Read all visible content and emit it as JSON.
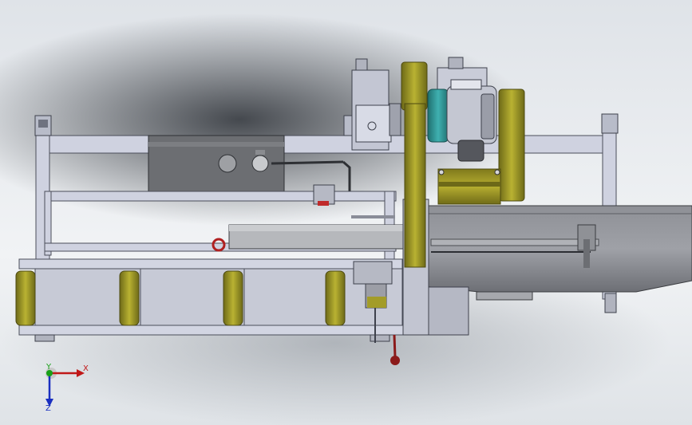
{
  "viewport": {
    "background_colors": [
      "#2a2e34",
      "#dfe3e8",
      "#f1f3f5"
    ]
  },
  "model": {
    "frame_color": "#cfd2e0",
    "roller_color": "#a9a128",
    "motor_color": "#2f9a9a",
    "handle_color": "#8b1a1a"
  },
  "triad": {
    "x_label": "X",
    "y_label": "Y",
    "z_label": "Z",
    "x_color": "#c01818",
    "y_color": "#18a018",
    "z_color": "#1a2fc0"
  }
}
